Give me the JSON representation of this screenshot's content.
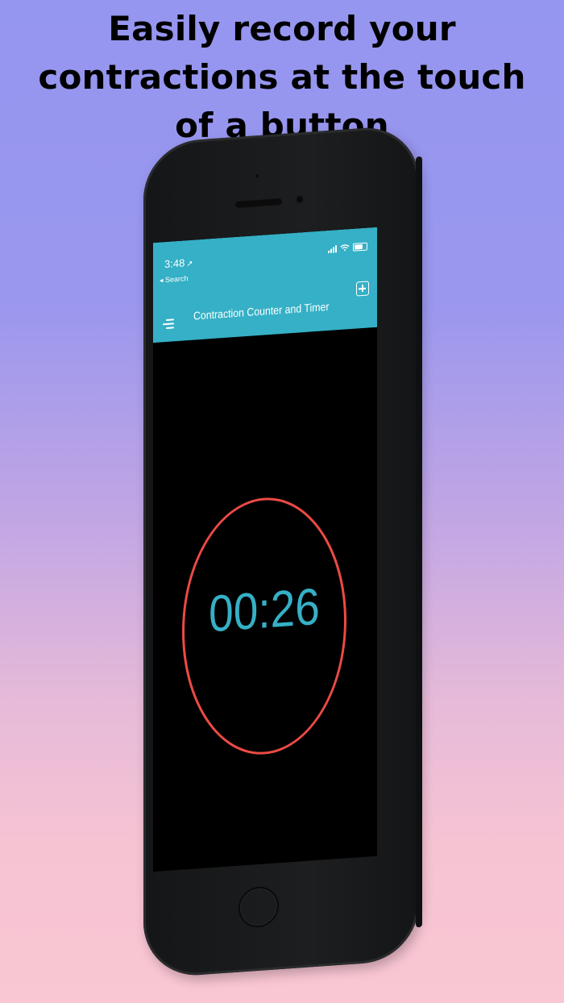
{
  "promo": {
    "headline_lines": [
      "Easily record your",
      "contractions at the touch",
      "of a button"
    ]
  },
  "status_bar": {
    "time": "3:48",
    "location_icon": "location-arrow-icon",
    "icons": [
      "signal-icon",
      "wifi-icon",
      "battery-icon"
    ]
  },
  "nav": {
    "back_label": "◂ Search",
    "menu_icon": "menu-icon",
    "title": "Contraction Counter and Timer",
    "add_icon": "add-icon"
  },
  "timer": {
    "value": "00:26",
    "ring_color": "#ec4a45",
    "text_color": "#35b0c6"
  },
  "colors": {
    "app_bar": "#35b0c6",
    "screen_bg": "#000000",
    "background_top": "#9596f0",
    "background_bottom": "#f9c6d3"
  }
}
